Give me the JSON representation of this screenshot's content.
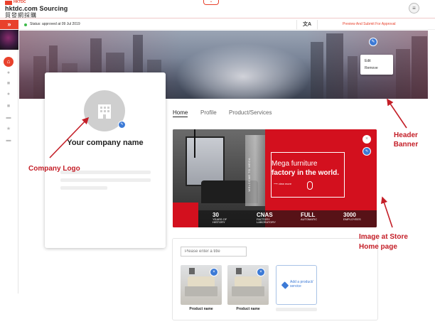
{
  "app": {
    "brand_small": "HKTDC",
    "brand_title": "hktdc.com Sourcing",
    "brand_sub": "貿發網採購",
    "top_chevron": "⌄",
    "menu_icon": "≡"
  },
  "sidebar": {
    "expand_glyph": "»",
    "home_glyph": "⌂",
    "icons": [
      "user-icon",
      "chat-icon",
      "settings-icon",
      "trash-icon",
      "video-icon",
      "star-icon",
      "folder-icon"
    ]
  },
  "status_bar": {
    "status_text": "Status: approved at 09 Jul 2019",
    "translate_glyph": "文A",
    "preview_label": "Preview And Submit For Approval",
    "status_color": "#3dbb4a"
  },
  "banner": {
    "edit_glyph": "✎",
    "menu_items": [
      "Edit",
      "Remove"
    ]
  },
  "company_card": {
    "name": "Your company name",
    "edit_glyph": "✎"
  },
  "tabs": [
    "Home",
    "Profile",
    "Product/Services"
  ],
  "store_image": {
    "headline_line1": "Mega furniture",
    "headline_line2": "factory in the world.",
    "view_more": "view more",
    "vertical_text": "WELCOME TO MEGA",
    "close_glyph": "×",
    "edit_glyph": "✎",
    "stats": [
      {
        "big": "30",
        "small": "YEARS OF HISTORY"
      },
      {
        "big": "CNAS",
        "small": "FACTORY LABORATORY"
      },
      {
        "big": "FULL",
        "small": "AUTOMATIC"
      },
      {
        "big": "3000",
        "small": "EMPLOYEES"
      }
    ]
  },
  "product_section": {
    "title_placeholder": "Please enter a title",
    "products": [
      {
        "name": "Product name",
        "remove_glyph": "×"
      },
      {
        "name": "Product name",
        "remove_glyph": "×"
      }
    ],
    "add_label": "Add a product/ service"
  },
  "annotations": {
    "header_banner": "Header\nBanner",
    "company_logo": "Company Logo",
    "store_image": "Image at Store\nHome page"
  },
  "colors": {
    "accent": "#e8412c",
    "annotation": "#c41e27",
    "link_blue": "#3c7ad6"
  }
}
